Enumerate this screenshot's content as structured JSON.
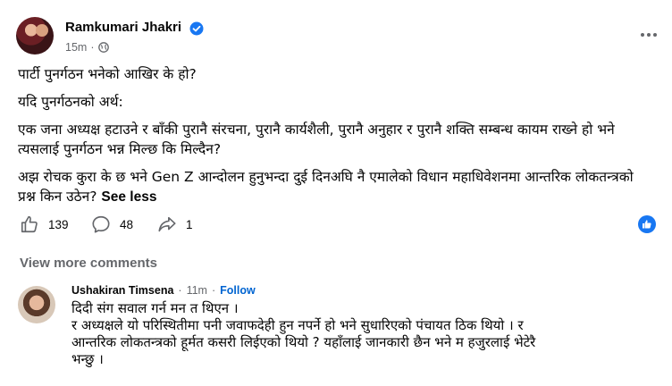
{
  "post": {
    "author": "Ramkumari Jhakri",
    "time": "15m",
    "separator": "·",
    "paragraphs": [
      "पार्टी पुनर्गठन भनेको आखिर के हो?",
      "यदि पुनर्गठनको अर्थ:",
      "एक जना अध्यक्ष हटाउने र बाँकी पुरानै संरचना, पुरानै कार्यशैली, पुरानै अनुहार र पुरानै शक्ति सम्बन्ध कायम राख्ने हो भने त्यसलाई पुनर्गठन भन्न मिल्छ कि मिल्दैन?",
      "अझ रोचक कुरा के छ भने Gen Z आन्दोलन हुनुभन्दा दुई दिनअघि नै एमालेको विधान महाधिवेशनमा आन्तरिक लोकतन्त्रको प्रश्न किन उठेन?"
    ],
    "see_less": "See less"
  },
  "actions": {
    "likes": "139",
    "comments": "48",
    "shares": "1"
  },
  "comments_section": {
    "view_more": "View more comments",
    "comment": {
      "name": "Ushakiran Timsena",
      "dot1": "·",
      "time": "11m",
      "dot2": "·",
      "follow": "Follow",
      "lines": [
        "दिदी संग सवाल गर्न मन त थिएन ।",
        "र अध्यक्षले यो परिस्थितीमा पनी जवाफदेही हुन नपर्ने हो भने सुधारिएको पंचायत ठिक थियो । र",
        "आन्तरिक लोकतन्त्रको हूर्मत कसरी लिईएको थियो ? यहाँलाई जानकारी छैन भने म हजुरलाई भेटेरै",
        "भन्छु ।"
      ]
    }
  },
  "colors": {
    "accent": "#1877f2",
    "muted": "#65676b",
    "follow": "#0064d1"
  }
}
